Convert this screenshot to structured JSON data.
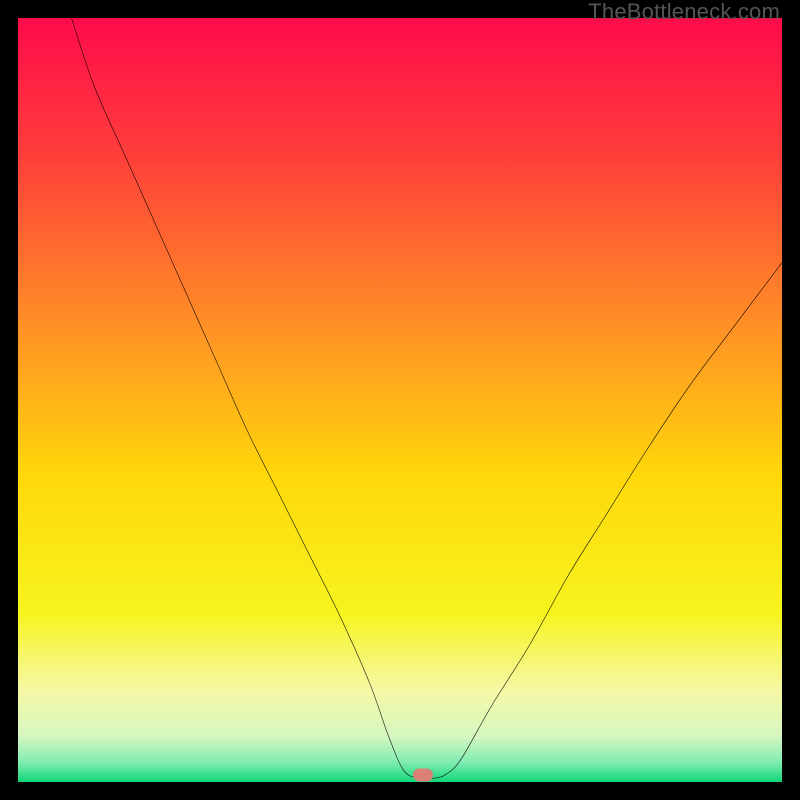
{
  "watermark": "TheBottleneck.com",
  "chart_data": {
    "type": "line",
    "title": "",
    "xlabel": "",
    "ylabel": "",
    "xlim": [
      0,
      100
    ],
    "ylim": [
      0,
      100
    ],
    "gradient_stops": [
      {
        "offset": 0,
        "color": "#ff0b4b"
      },
      {
        "offset": 0.18,
        "color": "#ff3e3a"
      },
      {
        "offset": 0.4,
        "color": "#ff8f26"
      },
      {
        "offset": 0.6,
        "color": "#ffd80a"
      },
      {
        "offset": 0.78,
        "color": "#f6f41f"
      },
      {
        "offset": 0.88,
        "color": "#f6f8a6"
      },
      {
        "offset": 0.94,
        "color": "#d5f7c0"
      },
      {
        "offset": 0.975,
        "color": "#7eecb1"
      },
      {
        "offset": 1.0,
        "color": "#10d779"
      }
    ],
    "series": [
      {
        "name": "bottleneck-curve",
        "x": [
          7,
          10,
          14,
          18,
          22,
          26,
          30,
          34,
          38,
          42,
          46,
          48.5,
          50.5,
          52.5,
          54.5,
          56,
          58,
          62,
          67,
          72,
          77,
          82,
          88,
          94,
          100
        ],
        "y": [
          100,
          91,
          82,
          73,
          64,
          55,
          46,
          38,
          30,
          22,
          13,
          6,
          1.5,
          0.5,
          0.5,
          1,
          3,
          10,
          18,
          27,
          35,
          43,
          52,
          60,
          68
        ]
      }
    ],
    "marker": {
      "x": 53.0,
      "y": 0.9,
      "color": "#da8074"
    }
  }
}
